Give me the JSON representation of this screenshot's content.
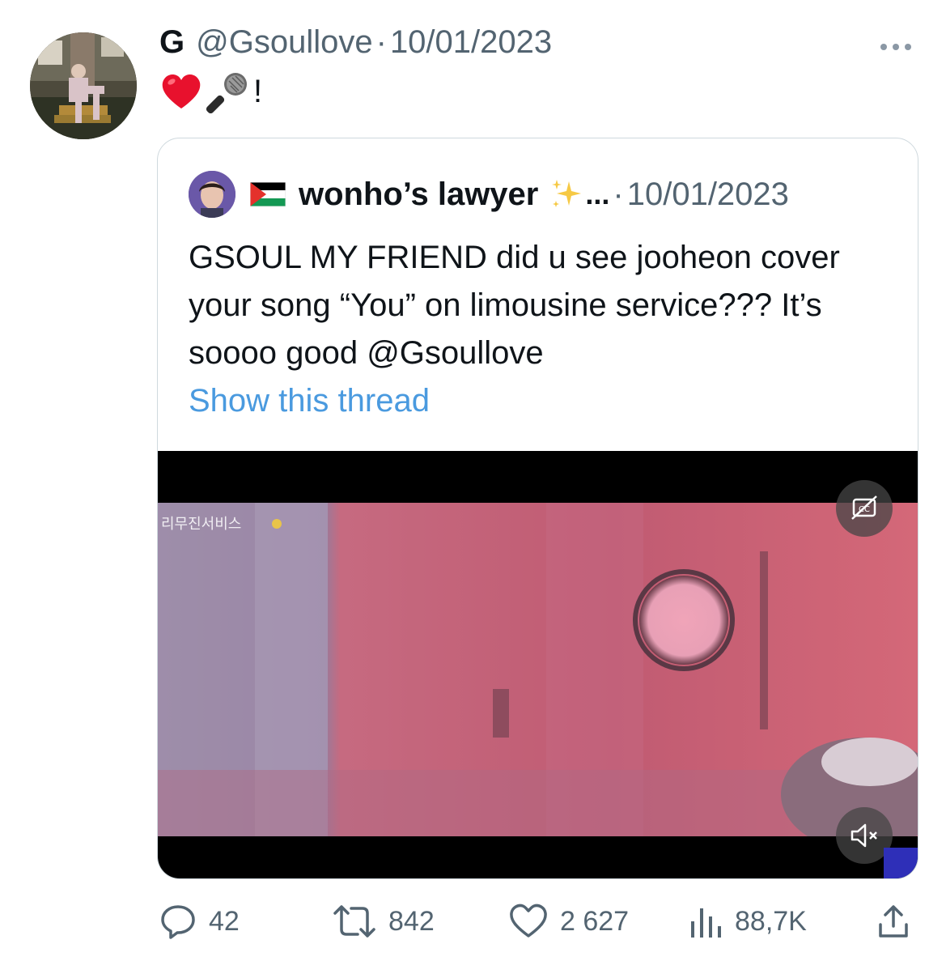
{
  "tweet": {
    "display_name": "G",
    "handle": "@Gsoullove",
    "separator": "·",
    "date": "10/01/2023",
    "text_suffix": "!",
    "emoji": [
      "red-heart",
      "microphone"
    ]
  },
  "quote": {
    "display_name": "wonho’s lawyer",
    "truncation": "...",
    "separator": "·",
    "date": "10/01/2023",
    "text": "GSOUL MY FRIEND did u see jooheon cover your song “You” on limousine service??? It’s soooo good @Gsoullove",
    "show_thread": "Show this thread",
    "video_overlay_text": "리무진서비스"
  },
  "stats": {
    "replies": "42",
    "retweets": "842",
    "likes": "2 627",
    "views": "88,7K"
  },
  "colors": {
    "text_primary": "#0f1419",
    "text_secondary": "#536471",
    "link": "#4a9adf",
    "border": "#cfd9de"
  }
}
